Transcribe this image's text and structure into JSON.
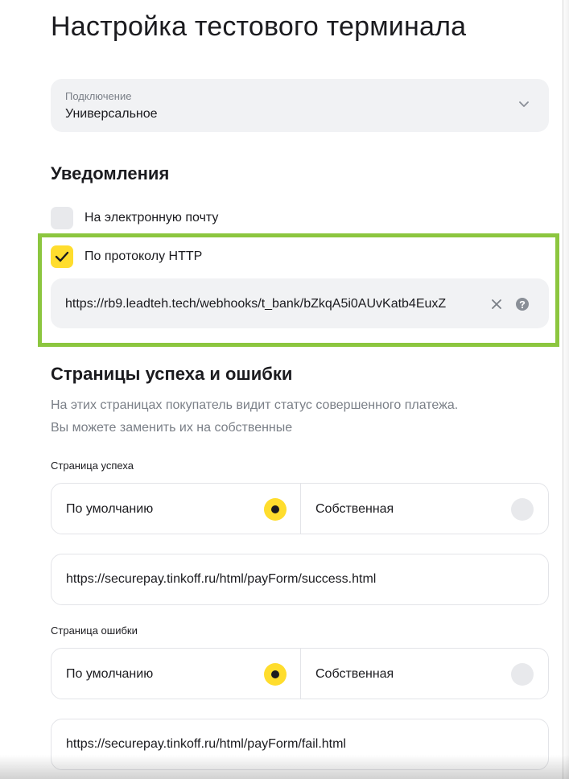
{
  "page": {
    "title": "Настройка тестового терминала"
  },
  "connection": {
    "label": "Подключение",
    "value": "Универсальное",
    "icon": "chevron-down-icon"
  },
  "notifications": {
    "title": "Уведомления",
    "email": {
      "label": "На электронную почту",
      "checked": false
    },
    "http": {
      "label": "По протоколу HTTP",
      "checked": true,
      "url": "https://rb9.leadteh.tech/webhooks/t_bank/bZkqA5i0AUvKatb4EuxZ",
      "clear_icon": "close-icon",
      "help_icon": "help-icon"
    },
    "highlight_color": "#8cc63f"
  },
  "pages": {
    "title": "Страницы успеха и ошибки",
    "description_line1": "На этих страницах покупатель видит статус совершенного платежа.",
    "description_line2": "Вы можете заменить их на собственные",
    "success": {
      "label": "Страница успеха",
      "option_default": "По умолчанию",
      "option_custom": "Собственная",
      "selected": "По умолчанию",
      "url": "https://securepay.tinkoff.ru/html/payForm/success.html"
    },
    "error": {
      "label": "Страница ошибки",
      "option_default": "По умолчанию",
      "option_custom": "Собственная",
      "selected": "По умолчанию",
      "url": "https://securepay.tinkoff.ru/html/payForm/fail.html"
    }
  },
  "colors": {
    "accent": "#ffdd2d",
    "field_bg": "#f1f2f4",
    "muted_text": "#7a7f87"
  }
}
